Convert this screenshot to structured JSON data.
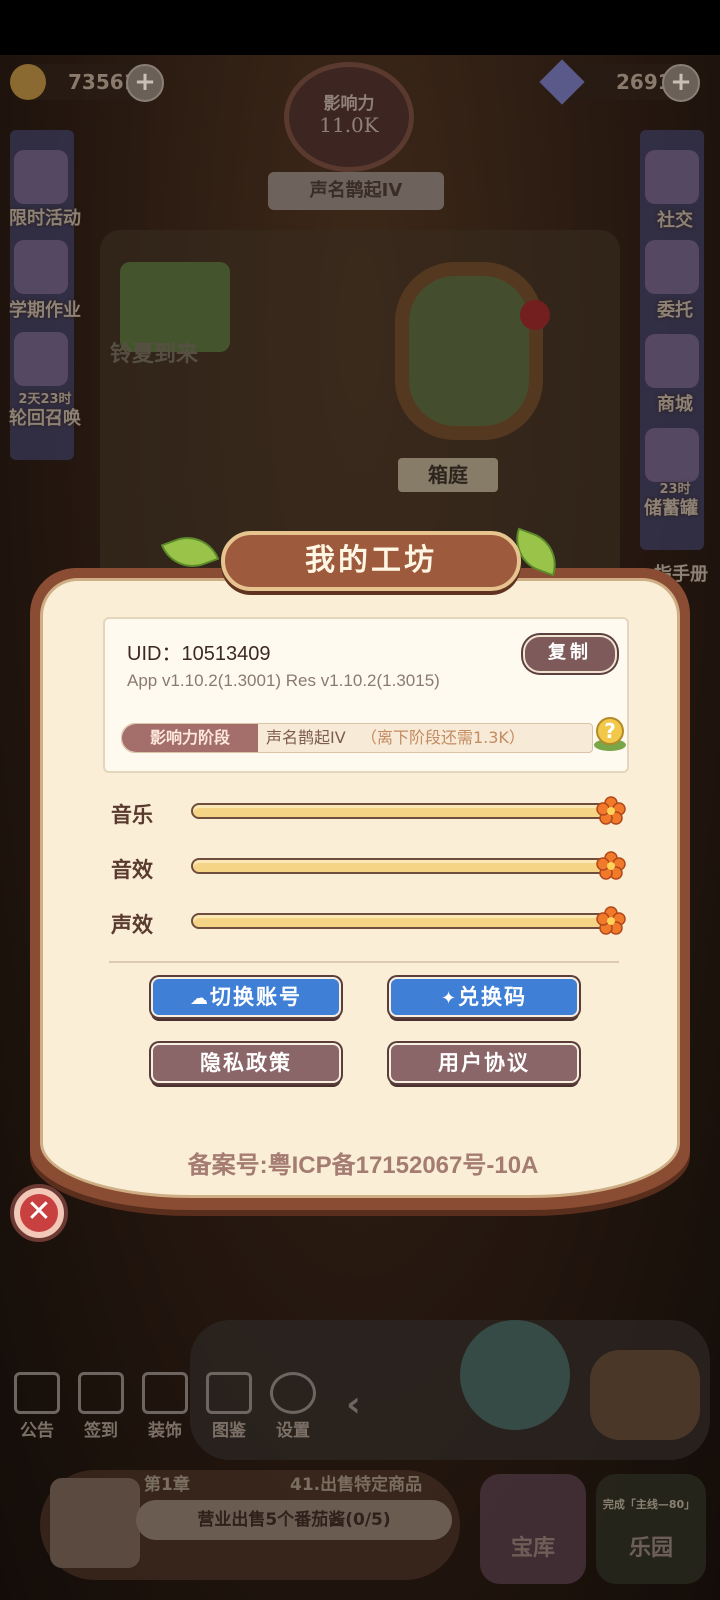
{
  "hud": {
    "coins": "73561",
    "gems": "2691",
    "influence_label": "影响力",
    "influence_value": "11.0K",
    "rank_banner": "声名鹊起IV"
  },
  "left_menu": [
    {
      "label": "限时活动"
    },
    {
      "label": "学期作业"
    },
    {
      "timer": "2天23时",
      "label": "轮回召唤"
    }
  ],
  "right_menu": [
    {
      "label": "社交"
    },
    {
      "label": "委托"
    },
    {
      "label": "商城"
    },
    {
      "timer": "23时",
      "label": "储蓄罐"
    },
    {
      "label": "指手册"
    }
  ],
  "scene_labels": {
    "shop_sign": "铃夏到来",
    "garden_sign": "箱庭"
  },
  "dialog": {
    "title": "我的工坊",
    "uid_label": "UID：",
    "uid": "10513409",
    "copy_button": "复制",
    "version": "App v1.10.2(1.3001)   Res v1.10.2(1.3015)",
    "stage_tag": "影响力阶段",
    "stage_name": "声名鹊起IV",
    "stage_note": "（离下阶段还需1.3K）",
    "sliders": [
      {
        "label": "音乐",
        "value": 1.0
      },
      {
        "label": "音效",
        "value": 1.0
      },
      {
        "label": "声效",
        "value": 1.0
      }
    ],
    "buttons": {
      "switch_account": "切换账号",
      "redeem_code": "兑换码",
      "privacy_policy": "隐私政策",
      "user_agreement": "用户协议"
    },
    "icp": "备案号:粤ICP备17152067号-10A"
  },
  "bottom_bar": [
    {
      "label": "公告"
    },
    {
      "label": "签到"
    },
    {
      "label": "装饰"
    },
    {
      "label": "图鉴"
    },
    {
      "label": "设置"
    }
  ],
  "quest": {
    "chapter": "第1章",
    "mission": "41.出售特定商品",
    "task": "营业出售5个番茄酱",
    "progress": "(0/5)",
    "main_line": "完成「主线—80」",
    "warehouse": "宝库",
    "paradise": "乐园"
  },
  "colors": {
    "accent_blue": "#3f7fd6",
    "dialog_bg": "#faefd6",
    "frame_brown": "#8a4d33",
    "slider_fill": "#f6d485",
    "close_red": "#c94040"
  }
}
